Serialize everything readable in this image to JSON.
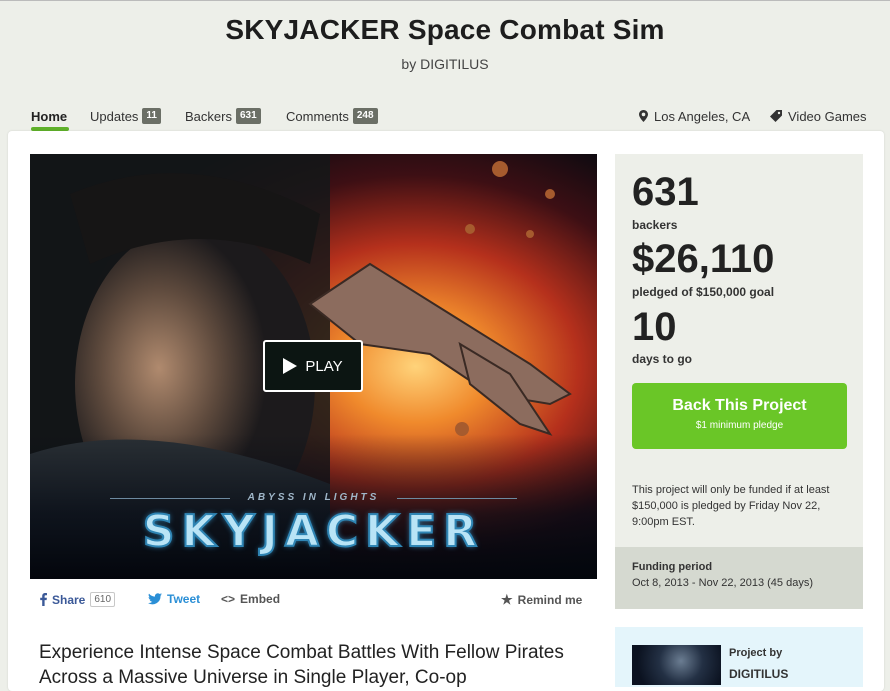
{
  "header": {
    "title": "SKYJACKER Space Combat Sim",
    "byline": "by DIGITILUS"
  },
  "nav": {
    "home": "Home",
    "updates": {
      "label": "Updates",
      "count": "11"
    },
    "backers": {
      "label": "Backers",
      "count": "631"
    },
    "comments": {
      "label": "Comments",
      "count": "248"
    },
    "location": "Los Angeles, CA",
    "category": "Video Games"
  },
  "video": {
    "play_label": "PLAY",
    "tagline": "ABYSS IN LIGHTS",
    "logo": "SKYJACKER"
  },
  "share": {
    "share_label": "Share",
    "share_count": "610",
    "tweet_label": "Tweet",
    "embed_label": "Embed",
    "remind_label": "Remind me"
  },
  "blurb": "Experience Intense Space Combat Battles With Fellow Pirates Across a Massive Universe in Single Player, Co-op",
  "stats": {
    "backers_value": "631",
    "backers_label": "backers",
    "pledged_value": "$26,110",
    "pledged_label": "pledged of $150,000 goal",
    "days_value": "10",
    "days_label": "days to go"
  },
  "back_button": {
    "label": "Back This Project",
    "sub": "$1 minimum pledge"
  },
  "funding_note": "This project will only be funded if at least $150,000 is pledged by Friday Nov 22, 9:00pm EST.",
  "funding_period": {
    "heading": "Funding period",
    "value": "Oct 8, 2013 - Nov 22, 2013 (45 days)"
  },
  "creator": {
    "heading": "Project by",
    "name": "DIGITILUS"
  },
  "colors": {
    "accent_green": "#6ac627",
    "nav_underline": "#5fb12a",
    "badge_gray": "#6b6f66",
    "twitter_blue": "#2b8fd6",
    "facebook_blue": "#3b5998"
  }
}
